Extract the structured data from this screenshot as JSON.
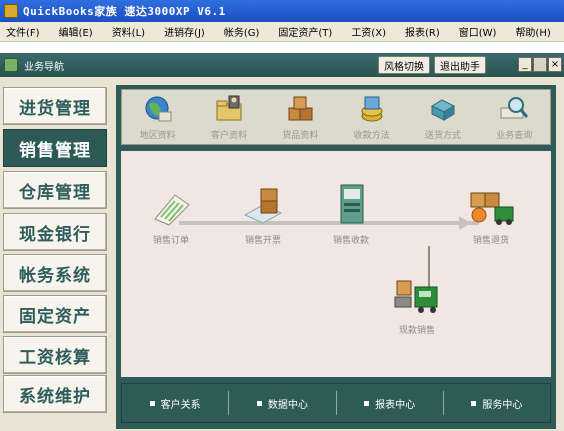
{
  "window": {
    "title": "QuickBooks家族 速达3000XP V6.1"
  },
  "menu": [
    "文件(F)",
    "编辑(E)",
    "资料(L)",
    "进销存(J)",
    "帐务(G)",
    "固定资产(T)",
    "工资(X)",
    "报表(R)",
    "窗口(W)",
    "帮助(H)"
  ],
  "nav": {
    "title": "业务导航",
    "style_button": "风格切换",
    "exit_button": "退出助手",
    "minimize": "_",
    "close": "×"
  },
  "sidebar": [
    "进货管理",
    "销售管理",
    "仓库管理",
    "现金银行",
    "帐务系统",
    "固定资产",
    "工资核算",
    "系统维护"
  ],
  "sidebar_active": "销售管理",
  "toolbar": [
    "地区资料",
    "客户资料",
    "货品资料",
    "收款方法",
    "送货方式",
    "业务查询"
  ],
  "flow": {
    "order": "销售订单",
    "invoice": "销售开票",
    "receipt": "销售收款",
    "return": "销售退货",
    "cash": "现款销售"
  },
  "bottom": [
    "客户关系",
    "数据中心",
    "报表中心",
    "服务中心"
  ]
}
